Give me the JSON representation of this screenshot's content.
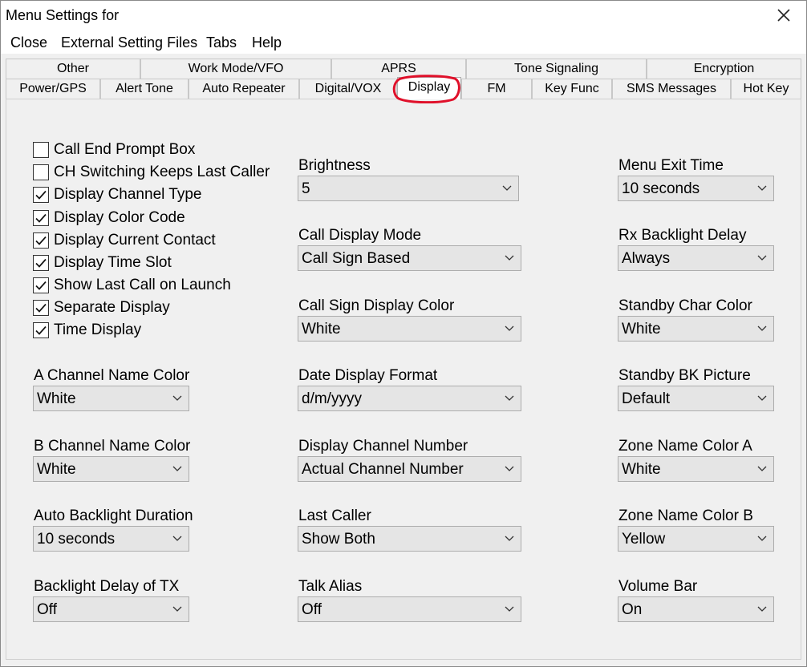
{
  "window": {
    "title": "Menu Settings for"
  },
  "menubar": {
    "items": [
      "Close",
      "External Setting Files",
      "Tabs",
      "Help"
    ]
  },
  "tabs": {
    "row1": [
      "Other",
      "Work Mode/VFO",
      "APRS",
      "Tone Signaling",
      "Encryption"
    ],
    "row2": [
      "Power/GPS",
      "Alert Tone",
      "Auto Repeater",
      "Digital/VOX",
      "Display",
      "FM",
      "Key Func",
      "SMS Messages",
      "Hot Key"
    ],
    "active": "Display",
    "highlight_color": "#e0102a"
  },
  "checkboxes": [
    {
      "label": "Call End Prompt Box",
      "checked": false
    },
    {
      "label": "CH Switching Keeps Last Caller",
      "checked": false
    },
    {
      "label": "Display Channel Type",
      "checked": true
    },
    {
      "label": "Display Color Code",
      "checked": true
    },
    {
      "label": "Display Current Contact",
      "checked": true
    },
    {
      "label": "Display Time Slot",
      "checked": true
    },
    {
      "label": "Show Last Call on Launch",
      "checked": true
    },
    {
      "label": "Separate Display",
      "checked": true
    },
    {
      "label": "Time Display",
      "checked": true
    }
  ],
  "left_fields": [
    {
      "label": "A Channel Name Color",
      "value": "White"
    },
    {
      "label": "B Channel Name Color",
      "value": "White"
    },
    {
      "label": "Auto Backlight Duration",
      "value": "10 seconds"
    },
    {
      "label": "Backlight Delay of TX",
      "value": "Off"
    }
  ],
  "middle_fields": [
    {
      "label": "Brightness",
      "value": "5"
    },
    {
      "label": "Call Display Mode",
      "value": "Call Sign Based"
    },
    {
      "label": "Call Sign Display Color",
      "value": "White"
    },
    {
      "label": "Date Display Format",
      "value": "d/m/yyyy"
    },
    {
      "label": "Display Channel Number",
      "value": "Actual Channel Number"
    },
    {
      "label": "Last Caller",
      "value": "Show Both"
    },
    {
      "label": "Talk Alias",
      "value": "Off"
    }
  ],
  "right_fields": [
    {
      "label": "Menu Exit Time",
      "value": "10 seconds"
    },
    {
      "label": "Rx Backlight Delay",
      "value": "Always"
    },
    {
      "label": "Standby Char Color",
      "value": "White"
    },
    {
      "label": "Standby BK Picture",
      "value": "Default"
    },
    {
      "label": "Zone Name Color A",
      "value": "White"
    },
    {
      "label": "Zone Name Color B",
      "value": "Yellow"
    },
    {
      "label": "Volume Bar",
      "value": "On"
    }
  ]
}
